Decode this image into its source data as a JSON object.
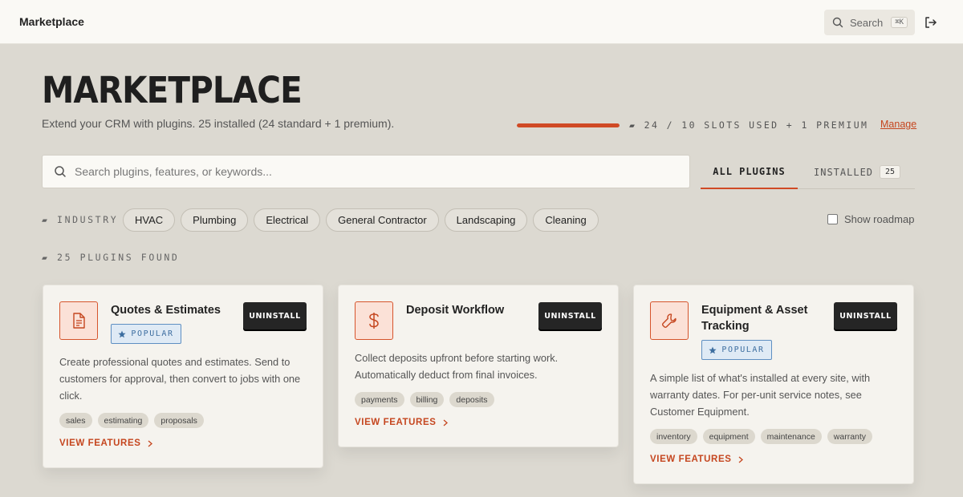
{
  "topbar": {
    "brand": "Marketplace",
    "search_label": "Search",
    "search_shortcut": "⌘K",
    "logout_icon": "logout-icon"
  },
  "header": {
    "title": "MARKETPLACE",
    "subtitle": "Extend your CRM with plugins. 25 installed (24 standard + 1 premium).",
    "slots_text": "▰ 24 / 10 SLOTS USED + 1 PREMIUM",
    "slots_fill_fraction": 1.0,
    "manage_label": "Manage"
  },
  "search": {
    "placeholder": "Search plugins, features, or keywords...",
    "value": ""
  },
  "tabs": [
    {
      "label": "ALL PLUGINS",
      "active": true
    },
    {
      "label": "INSTALLED",
      "count": "25",
      "active": false
    }
  ],
  "filters": {
    "industry_label": "▰ INDUSTRY",
    "chips": [
      "HVAC",
      "Plumbing",
      "Electrical",
      "General Contractor",
      "Landscaping",
      "Cleaning"
    ],
    "roadmap_label": "Show roadmap",
    "roadmap_checked": false
  },
  "results": {
    "found_label": "▰ 25 PLUGINS FOUND"
  },
  "cards": [
    {
      "name": "Quotes & Estimates",
      "icon": "document-icon",
      "popular": true,
      "popular_label": "POPULAR",
      "action_label": "UNINSTALL",
      "description": "Create professional quotes and estimates. Send to customers for approval, then convert to jobs with one click.",
      "tags": [
        "sales",
        "estimating",
        "proposals"
      ],
      "link_label": "VIEW FEATURES"
    },
    {
      "name": "Deposit Workflow",
      "icon": "dollar-icon",
      "popular": false,
      "action_label": "UNINSTALL",
      "description": "Collect deposits upfront before starting work. Automatically deduct from final invoices.",
      "tags": [
        "payments",
        "billing",
        "deposits"
      ],
      "link_label": "VIEW FEATURES"
    },
    {
      "name": "Equipment & Asset Tracking",
      "icon": "wrench-icon",
      "popular": true,
      "popular_label": "POPULAR",
      "action_label": "UNINSTALL",
      "description": "A simple list of what's installed at every site, with warranty dates. For per-unit service notes, see Customer Equipment.",
      "tags": [
        "inventory",
        "equipment",
        "maintenance",
        "warranty"
      ],
      "link_label": "VIEW FEATURES"
    }
  ],
  "colors": {
    "accent": "#d04a25",
    "background": "#dcd9d1",
    "card": "#f5f3ee",
    "popular_blue": "#3d6ea0"
  }
}
